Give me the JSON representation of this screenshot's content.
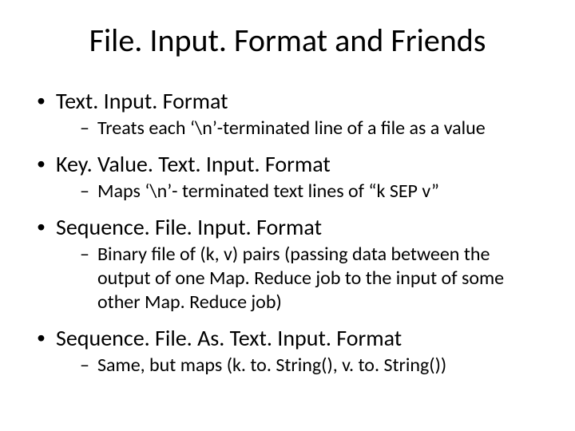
{
  "title": "File. Input. Format and Friends",
  "bullets": [
    {
      "label": "Text. Input. Format",
      "sub": [
        "Treats each ‘\\n’-terminated line of a file as a value"
      ]
    },
    {
      "label": "Key. Value. Text. Input. Format",
      "sub": [
        "Maps ‘\\n’- terminated text lines of “k SEP v”"
      ]
    },
    {
      "label": "Sequence. File. Input. Format",
      "sub": [
        "Binary file of (k, v) pairs  (passing data between the output of one Map. Reduce job to the input of some other Map. Reduce job)"
      ]
    },
    {
      "label": "Sequence. File. As. Text. Input. Format",
      "sub": [
        "Same, but maps (k. to. String(), v. to. String())"
      ]
    }
  ]
}
